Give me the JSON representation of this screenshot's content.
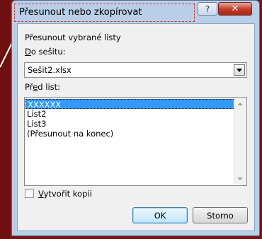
{
  "dialog": {
    "title": "Přesunout nebo zkopírovat",
    "help_glyph": "?",
    "close_glyph": "✕"
  },
  "form": {
    "heading": "Přesunout vybrané listy",
    "workbook_label_u": "D",
    "workbook_label_rest": "o sešitu:",
    "workbook_value": "Sešit2.xlsx",
    "before_label_pre": "Př",
    "before_label_u": "e",
    "before_label_rest": "d list:",
    "sheets": [
      "XXXXXX",
      "List2",
      "List3",
      "(Přesunout na konec)"
    ],
    "selected_index": 0,
    "copy_label_u": "V",
    "copy_label_rest": "ytvořit kopii",
    "copy_checked": false
  },
  "buttons": {
    "ok": "OK",
    "cancel": "Storno"
  }
}
